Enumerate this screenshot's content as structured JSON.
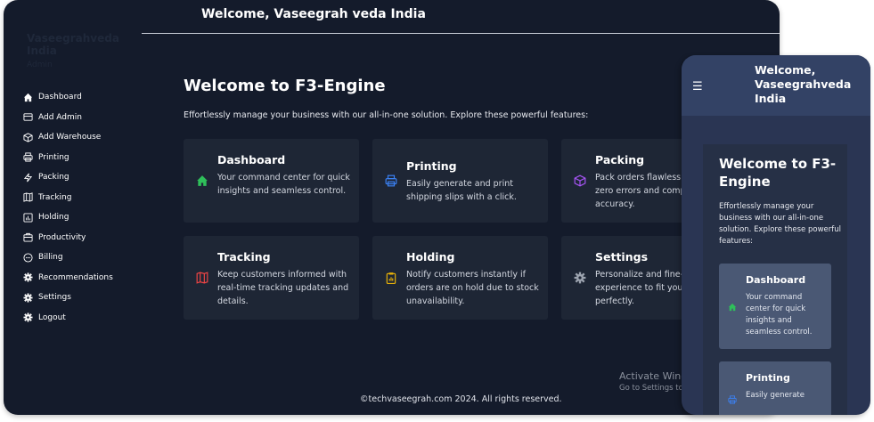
{
  "header": {
    "title": "Welcome, Vaseegrah veda India"
  },
  "brand": {
    "name": "Vaseegrahveda India",
    "sub": "Admin"
  },
  "sidebar": {
    "items": [
      {
        "label": "Dashboard",
        "icon": "home-icon"
      },
      {
        "label": "Add Admin",
        "icon": "admin-icon"
      },
      {
        "label": "Add Warehouse",
        "icon": "box-icon"
      },
      {
        "label": "Printing",
        "icon": "printer-icon"
      },
      {
        "label": "Packing",
        "icon": "bolt-icon"
      },
      {
        "label": "Tracking",
        "icon": "map-icon"
      },
      {
        "label": "Holding",
        "icon": "chart-icon"
      },
      {
        "label": "Productivity",
        "icon": "briefcase-icon"
      },
      {
        "label": "Billing",
        "icon": "chat-icon"
      },
      {
        "label": "Recommendations",
        "icon": "gear-icon"
      },
      {
        "label": "Settings",
        "icon": "gear-icon"
      },
      {
        "label": "Logout",
        "icon": "gear-icon"
      }
    ]
  },
  "main": {
    "title": "Welcome to F3-Engine",
    "subtitle": "Effortlessly manage your business with our all-in-one solution. Explore these powerful features:",
    "cards": [
      {
        "title": "Dashboard",
        "text": "Your command center for quick insights and seamless control.",
        "icon": "home-icon",
        "icon_color": "#2fbf5a"
      },
      {
        "title": "Printing",
        "text": "Easily generate and print shipping slips with a click.",
        "icon": "printer-icon",
        "icon_color": "#3b82f6"
      },
      {
        "title": "Packing",
        "text": "Pack orders flawlessly, ensuring zero errors and complete accuracy.",
        "icon": "box-icon",
        "icon_color": "#a855f7"
      },
      {
        "title": "Tracking",
        "text": "Keep customers informed with real-time tracking updates and details.",
        "icon": "map-icon",
        "icon_color": "#ef4444"
      },
      {
        "title": "Holding",
        "text": "Notify customers instantly if orders are on hold due to stock unavailability.",
        "icon": "clipboard-icon",
        "icon_color": "#eab308"
      },
      {
        "title": "Settings",
        "text": "Personalize and fine-tune your experience to fit your business perfectly.",
        "icon": "gear-icon",
        "icon_color": "#9ca3af"
      }
    ]
  },
  "footer": {
    "text": "©techvaseegrah.com 2024. All rights reserved."
  },
  "watermark": {
    "title": "Activate Windows",
    "sub": "Go to Settings to activate Windows."
  },
  "mobile": {
    "header_title": "Welcome, Vaseegrahveda India",
    "menu_icon": "hamburger-icon",
    "welcome": "Welcome to F3-Engine",
    "subtitle": "Effortlessly manage your business with our all-in-one solution. Explore these powerful features:",
    "cards": [
      {
        "title": "Dashboard",
        "text": "Your command center for quick insights and seamless control.",
        "icon": "home-icon"
      },
      {
        "title": "Printing",
        "text": "Easily generate",
        "icon": "printer-icon"
      }
    ]
  }
}
